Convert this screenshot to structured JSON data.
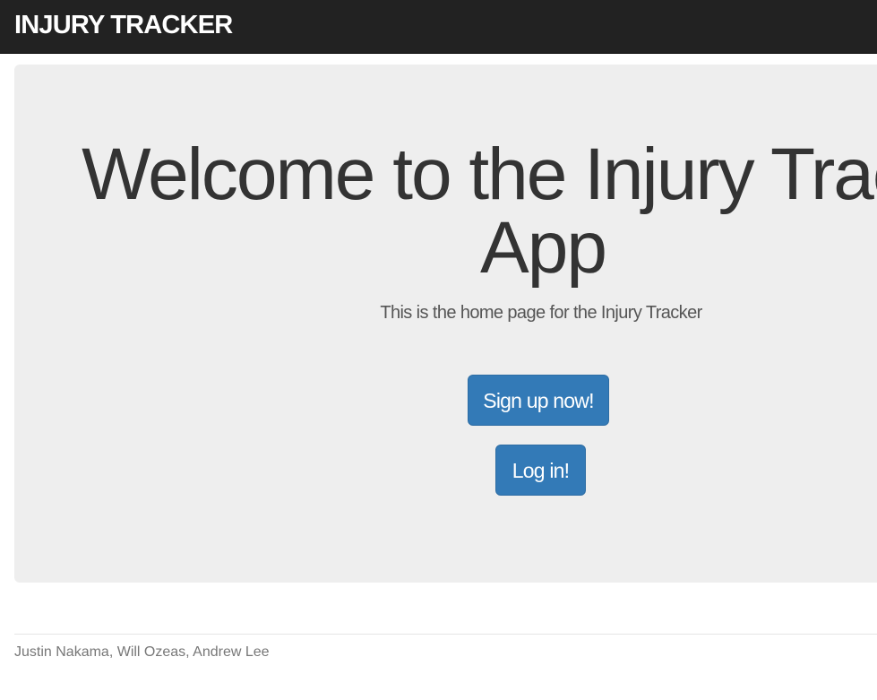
{
  "navbar": {
    "brand": "INJURY TRACKER",
    "background_color": "#222222"
  },
  "hero": {
    "title_line1": "Welcome to the Injury Tracker",
    "title_line2": "App",
    "subtitle": "This is the home page for the Injury Tracker",
    "background_color": "#eeeeee"
  },
  "actions": {
    "signup_label": "Sign up now!",
    "login_label": "Log in!",
    "button_color": "#337ab7"
  },
  "footer": {
    "credits": "Justin Nakama, Will Ozeas, Andrew Lee"
  }
}
